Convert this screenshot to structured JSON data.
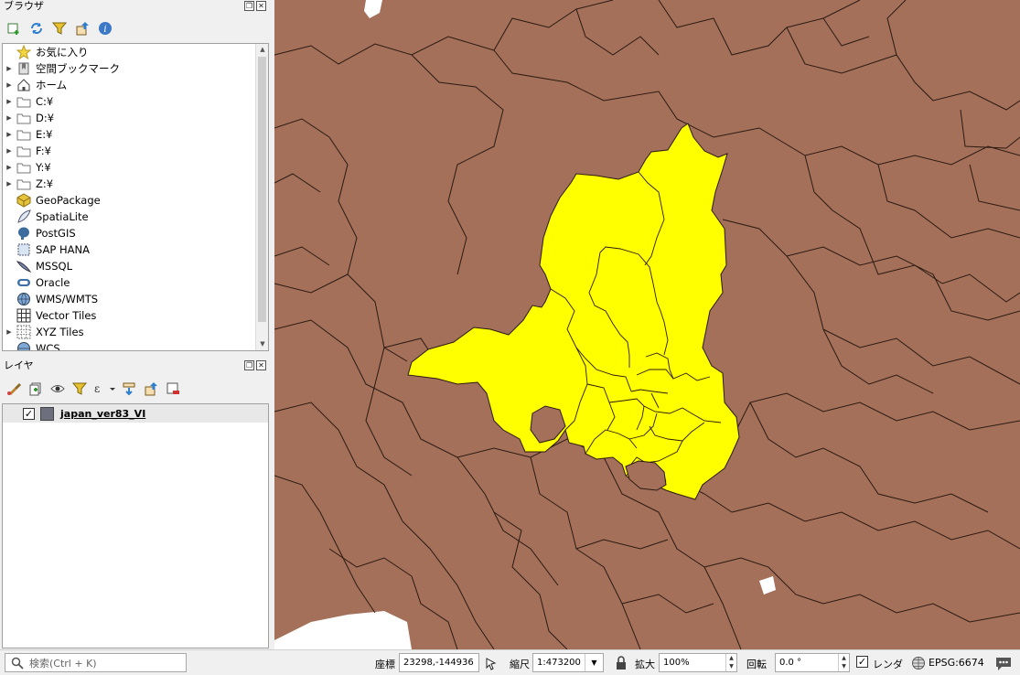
{
  "browser_panel": {
    "title": "ブラウザ",
    "toolbar_icons": [
      "add-layer-icon",
      "refresh-icon",
      "filter-icon",
      "collapse-icon",
      "info-icon"
    ],
    "items": [
      {
        "label": "お気に入り",
        "icon": "star-icon",
        "expandable": false
      },
      {
        "label": "空間ブックマーク",
        "icon": "bookmark-icon",
        "expandable": true
      },
      {
        "label": "ホーム",
        "icon": "home-icon",
        "expandable": true
      },
      {
        "label": "C:¥",
        "icon": "folder-icon",
        "expandable": true
      },
      {
        "label": "D:¥",
        "icon": "folder-icon",
        "expandable": true
      },
      {
        "label": "E:¥",
        "icon": "folder-icon",
        "expandable": true
      },
      {
        "label": "F:¥",
        "icon": "folder-icon",
        "expandable": true
      },
      {
        "label": "Y:¥",
        "icon": "folder-icon",
        "expandable": true
      },
      {
        "label": "Z:¥",
        "icon": "folder-icon",
        "expandable": true
      },
      {
        "label": "GeoPackage",
        "icon": "geopackage-icon",
        "expandable": false
      },
      {
        "label": "SpatiaLite",
        "icon": "spatialite-icon",
        "expandable": false
      },
      {
        "label": "PostGIS",
        "icon": "postgis-icon",
        "expandable": false
      },
      {
        "label": "SAP HANA",
        "icon": "sap-hana-icon",
        "expandable": false
      },
      {
        "label": "MSSQL",
        "icon": "mssql-icon",
        "expandable": false
      },
      {
        "label": "Oracle",
        "icon": "oracle-icon",
        "expandable": false
      },
      {
        "label": "WMS/WMTS",
        "icon": "wms-icon",
        "expandable": false
      },
      {
        "label": "Vector Tiles",
        "icon": "vector-tiles-icon",
        "expandable": false
      },
      {
        "label": "XYZ Tiles",
        "icon": "xyz-tiles-icon",
        "expandable": true
      },
      {
        "label": "WCS",
        "icon": "wcs-icon",
        "expandable": false
      }
    ]
  },
  "layers_panel": {
    "title": "レイヤ",
    "layers": [
      {
        "name": "japan_ver83_VI",
        "checked": true,
        "color": "#6d6f7d"
      }
    ]
  },
  "map": {
    "base_color": "#a4705a",
    "highlight_color": "#ffff00",
    "border_color": "#2b1a12"
  },
  "status_bar": {
    "search_placeholder": "検索(Ctrl + K)",
    "coordinate_label": "座標",
    "coordinate_value": "23298,-144936",
    "scale_label": "縮尺",
    "scale_value": "1:473200",
    "magnifier_label": "拡大",
    "magnifier_value": "100%",
    "rotation_label": "回転",
    "rotation_value": "0.0 °",
    "render_label": "レンダ",
    "render_checked": true,
    "crs": "EPSG:6674"
  }
}
